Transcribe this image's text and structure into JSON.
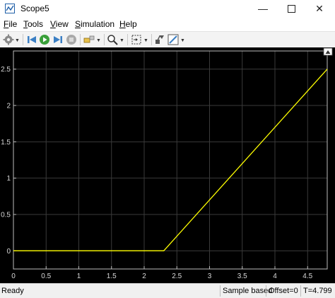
{
  "window": {
    "title": "Scope5"
  },
  "menu": [
    {
      "label": "File",
      "key": "F",
      "rest": "ile"
    },
    {
      "label": "Tools",
      "key": "T",
      "rest": "ools"
    },
    {
      "label": "View",
      "key": "V",
      "rest": "iew"
    },
    {
      "label": "Simulation",
      "key": "S",
      "rest": "imulation"
    },
    {
      "label": "Help",
      "key": "H",
      "rest": "elp"
    }
  ],
  "toolbar": {
    "icons": [
      "settings-icon",
      "step-back-icon",
      "run-icon",
      "step-forward-icon",
      "stop-icon",
      "highlight-icon",
      "zoom-icon",
      "autoscale-icon",
      "cursor-measure-icon",
      "style-icon"
    ]
  },
  "statusbar": {
    "ready": "Ready",
    "mode": "Sample based",
    "offset": "Offset=0",
    "time": "T=4.799"
  },
  "colors": {
    "background": "#000000",
    "grid": "#3a3a3a",
    "axis_text": "#d8d8d8",
    "signal": "#ffff00"
  },
  "chart_data": {
    "type": "line",
    "x": [
      0,
      2.3,
      4.8
    ],
    "series": [
      {
        "values": [
          0,
          0,
          2.5
        ]
      }
    ],
    "xlim": [
      0,
      4.8
    ],
    "ylim": [
      -0.25,
      2.75
    ],
    "xticks": [
      0,
      0.5,
      1,
      1.5,
      2,
      2.5,
      3,
      3.5,
      4,
      4.5
    ],
    "xtick_labels": [
      "0",
      "0.5",
      "1",
      "1.5",
      "2",
      "2.5",
      "3",
      "3.5",
      "4",
      "4.5"
    ],
    "yticks": [
      0,
      0.5,
      1,
      1.5,
      2,
      2.5
    ],
    "ytick_labels": [
      "0",
      "0.5",
      "1",
      "1.5",
      "2",
      "2.5"
    ],
    "grid": true
  }
}
